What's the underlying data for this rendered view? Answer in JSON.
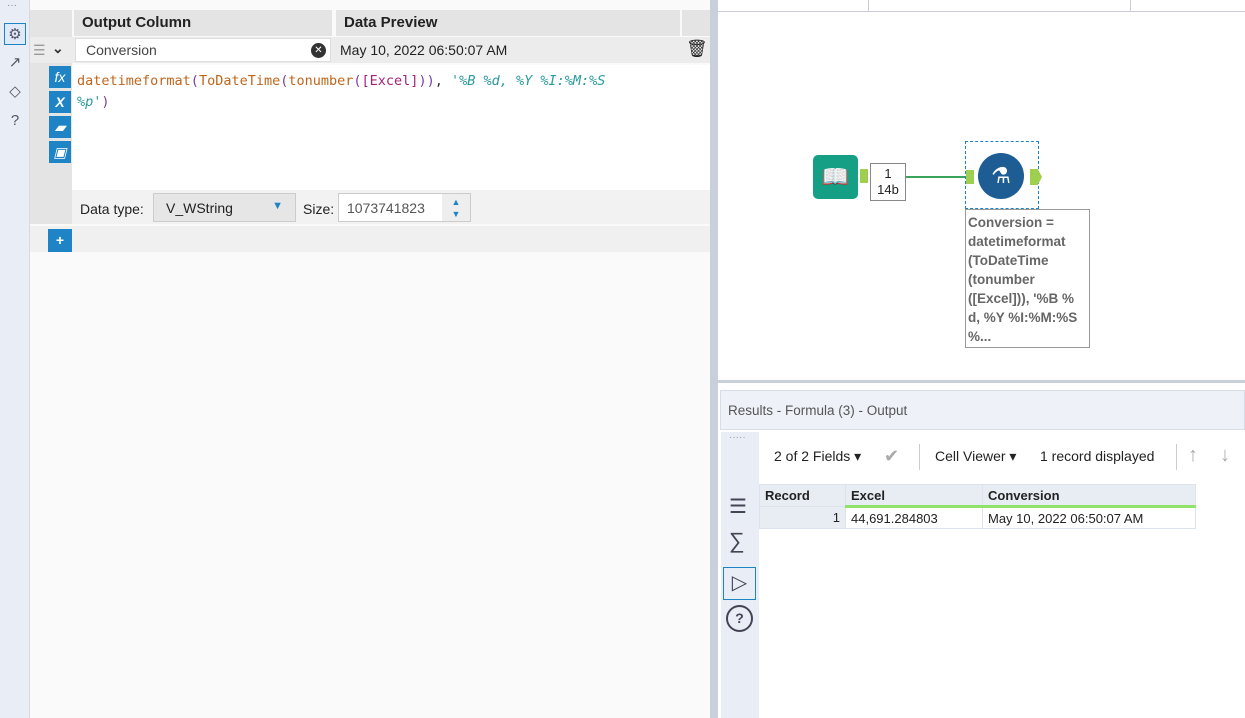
{
  "left_panel": {
    "headers": {
      "output_column": "Output Column",
      "data_preview": "Data Preview"
    },
    "row": {
      "output_column_value": "Conversion",
      "data_preview": "May 10, 2022 06:50:07 AM"
    },
    "expression": {
      "p1": "datetimeformat",
      "p2": "(",
      "p3": "ToDateTime",
      "p4": "(",
      "p5": "tonumber",
      "p6": "(",
      "p7": "[Excel]",
      "p8": "))",
      "p9": ", ",
      "p10": "'%B %d, %Y %I:%M:%S",
      "p11": "%p'",
      "p12": ")"
    },
    "data_type_label": "Data type:",
    "data_type_value": "V_WString",
    "size_label": "Size:",
    "size_value": "1073741823",
    "add_label": "+"
  },
  "canvas": {
    "connection_label": {
      "count": "1",
      "size": "14b"
    },
    "annotation": [
      "Conversion =",
      "datetimeformat",
      "(ToDateTime",
      "(tonumber",
      "([Excel])), '%B %",
      "d, %Y %I:%M:%S",
      "%..."
    ]
  },
  "results": {
    "title": "Results - Formula (3) - Output",
    "fields": "2 of 2 Fields",
    "viewer": "Cell Viewer",
    "records": "1 record displayed",
    "columns": [
      "Record",
      "Excel",
      "Conversion"
    ],
    "rows": [
      {
        "record": "1",
        "excel": "44,691.284803",
        "conversion": "May 10, 2022 06:50:07 AM"
      }
    ]
  },
  "colors": {
    "accent": "#1e84c6",
    "input_tool": "#15a086",
    "formula_tool": "#1d5d94",
    "anchor": "#9fcf4f"
  }
}
